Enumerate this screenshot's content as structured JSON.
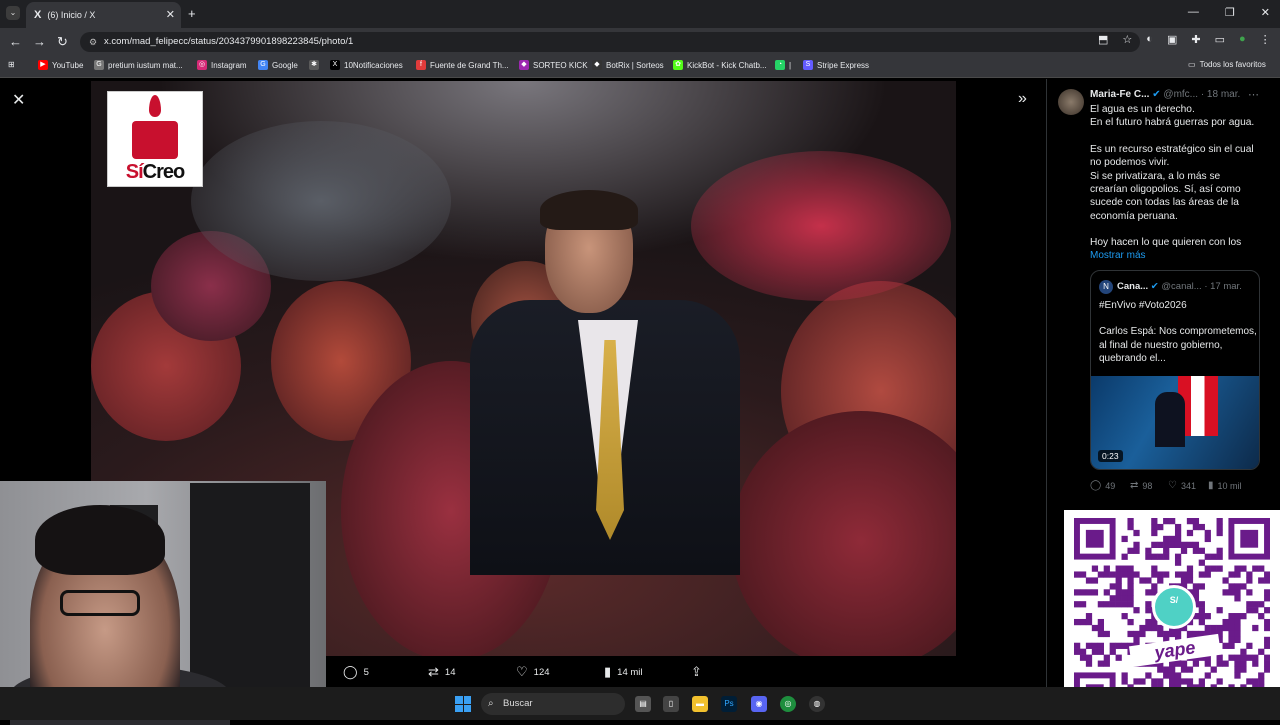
{
  "browser": {
    "tab_title": "(6) Inicio / X",
    "tab_icon": "X",
    "url": "x.com/mad_felipecc/status/2034379901898223845/photo/1",
    "new_tab_label": "+",
    "tab_close": "✕",
    "tab_list": "⌄",
    "window_controls": [
      "—",
      "❐",
      "✕"
    ],
    "bookmarks": [
      {
        "label": "YouTube",
        "icon_color": "#ff0000",
        "glyph": "▶"
      },
      {
        "label": "pretium iustum mat...",
        "icon_color": "#777777",
        "glyph": "G"
      },
      {
        "label": "Instagram",
        "icon_color": "#d62976",
        "glyph": "◎"
      },
      {
        "label": "Google",
        "icon_color": "#4285f4",
        "glyph": "G"
      },
      {
        "label": "",
        "icon_color": "#5a5a5a",
        "glyph": "✱"
      },
      {
        "label": "10Notificaciones",
        "icon_color": "#000000",
        "glyph": "X"
      },
      {
        "label": "Fuente de Grand Th...",
        "icon_color": "#e03b3b",
        "glyph": "f"
      },
      {
        "label": "SORTEO KICK",
        "icon_color": "#9c27b0",
        "glyph": "◆"
      },
      {
        "label": "BotRix | Sorteos",
        "icon_color": "#333333",
        "glyph": "◆"
      },
      {
        "label": "KickBot - Kick Chatb...",
        "icon_color": "#53fc18",
        "glyph": "✿"
      },
      {
        "label": "|",
        "icon_color": "#25d366",
        "glyph": "◔"
      },
      {
        "label": "Stripe Express",
        "icon_color": "#635bff",
        "glyph": "S"
      }
    ],
    "all_favorites": "Todos los favoritos"
  },
  "viewer": {
    "close": "✕",
    "expand": "»",
    "logo_si": "Sí",
    "logo_creo": "Creo",
    "actions": {
      "replies": "5",
      "reposts": "14",
      "likes": "124",
      "views": "14 mil"
    }
  },
  "tweet": {
    "author": "Maria-Fe C...",
    "handle": "@mfc...",
    "date": "· 18 mar.",
    "paragraphs": [
      "El agua es un derecho.\nEn el futuro habrá guerras por agua.",
      "Es un recurso estratégico sin el cual no podemos vivir.\nSi se privatizara, a lo más se crearían oligopolios. Sí, así como sucede con todas las áreas de la economía peruana.",
      "Hoy hacen lo que quieren con los"
    ],
    "show_more": "Mostrar más",
    "quote": {
      "author": "Cana...",
      "handle": "@canal...",
      "date": "· 17 mar.",
      "hashtags": "#EnVivo #Voto2026",
      "text": "Carlos Espá: Nos comprometemos, al final de nuestro gobierno, quebrando el...",
      "duration": "0:23"
    },
    "stats": {
      "replies": "49",
      "reposts": "98",
      "likes": "341",
      "views": "10 mil"
    }
  },
  "qr": {
    "badge": "S/",
    "brand": "yape",
    "brand_color": "#6a1b8a"
  },
  "taskbar": {
    "search_label": "Buscar"
  }
}
